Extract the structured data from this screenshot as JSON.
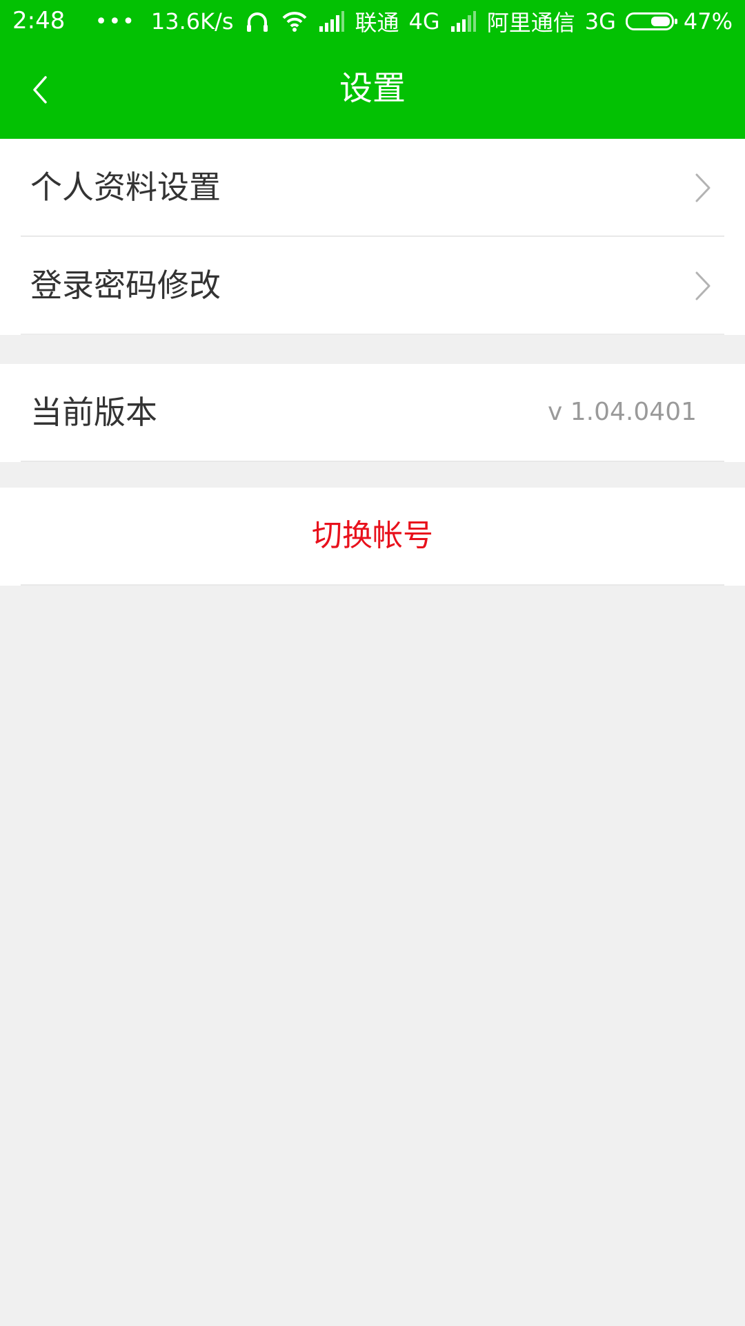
{
  "status_bar": {
    "time": "2:48",
    "dots": "•••",
    "speed": "13.6K/s",
    "carrier1": "联通",
    "network1": "4G",
    "carrier2": "阿里通信",
    "network2": "3G",
    "battery": "47%",
    "battery_level": 0.47
  },
  "nav": {
    "title": "设置"
  },
  "group1": {
    "items": [
      {
        "label": "个人资料设置"
      },
      {
        "label": "登录密码修改"
      }
    ]
  },
  "group2": {
    "version_label": "当前版本",
    "version_value": "v 1.04.0401"
  },
  "group3": {
    "switch_account": "切换帐号"
  },
  "colors": {
    "header": "#03c103",
    "background": "#f0f0f0",
    "danger": "#e8111c",
    "secondary_text": "#9a9a9a"
  }
}
